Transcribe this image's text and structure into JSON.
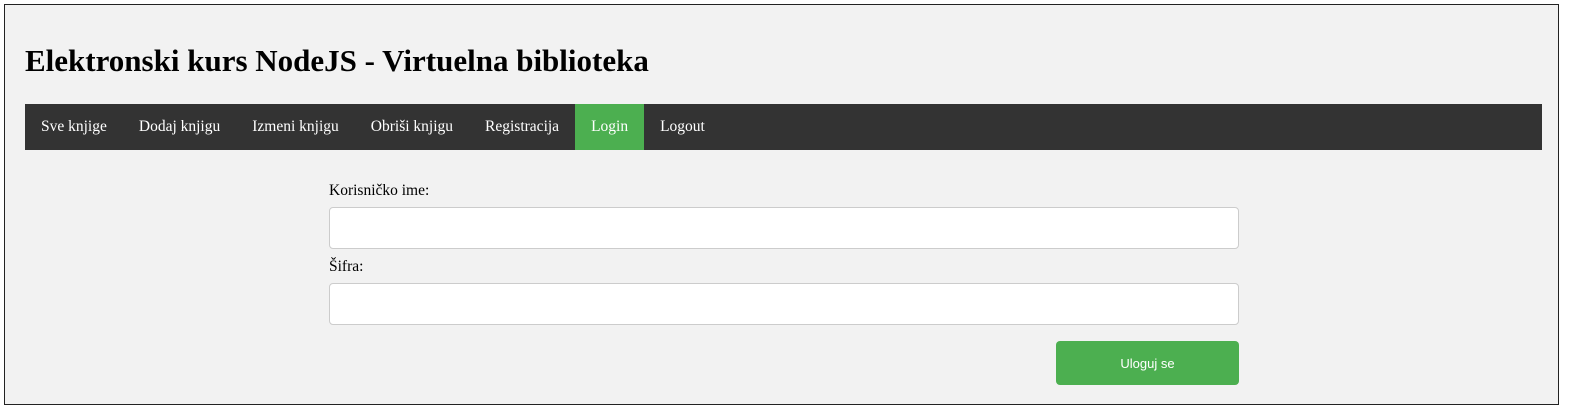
{
  "header": {
    "title": "Elektronski kurs NodeJS - Virtuelna biblioteka"
  },
  "nav": {
    "items": [
      {
        "label": "Sve knjige",
        "active": false
      },
      {
        "label": "Dodaj knjigu",
        "active": false
      },
      {
        "label": "Izmeni knjigu",
        "active": false
      },
      {
        "label": "Obriši knjigu",
        "active": false
      },
      {
        "label": "Registracija",
        "active": false
      },
      {
        "label": "Login",
        "active": true
      },
      {
        "label": "Logout",
        "active": false
      }
    ],
    "colors": {
      "bar": "#333333",
      "active": "#4caf50",
      "text": "#ffffff"
    }
  },
  "form": {
    "username_label": "Korisničko ime:",
    "username_value": "",
    "password_label": "Šifra:",
    "password_value": "",
    "submit_label": "Uloguj se",
    "submit_color": "#4caf50"
  }
}
